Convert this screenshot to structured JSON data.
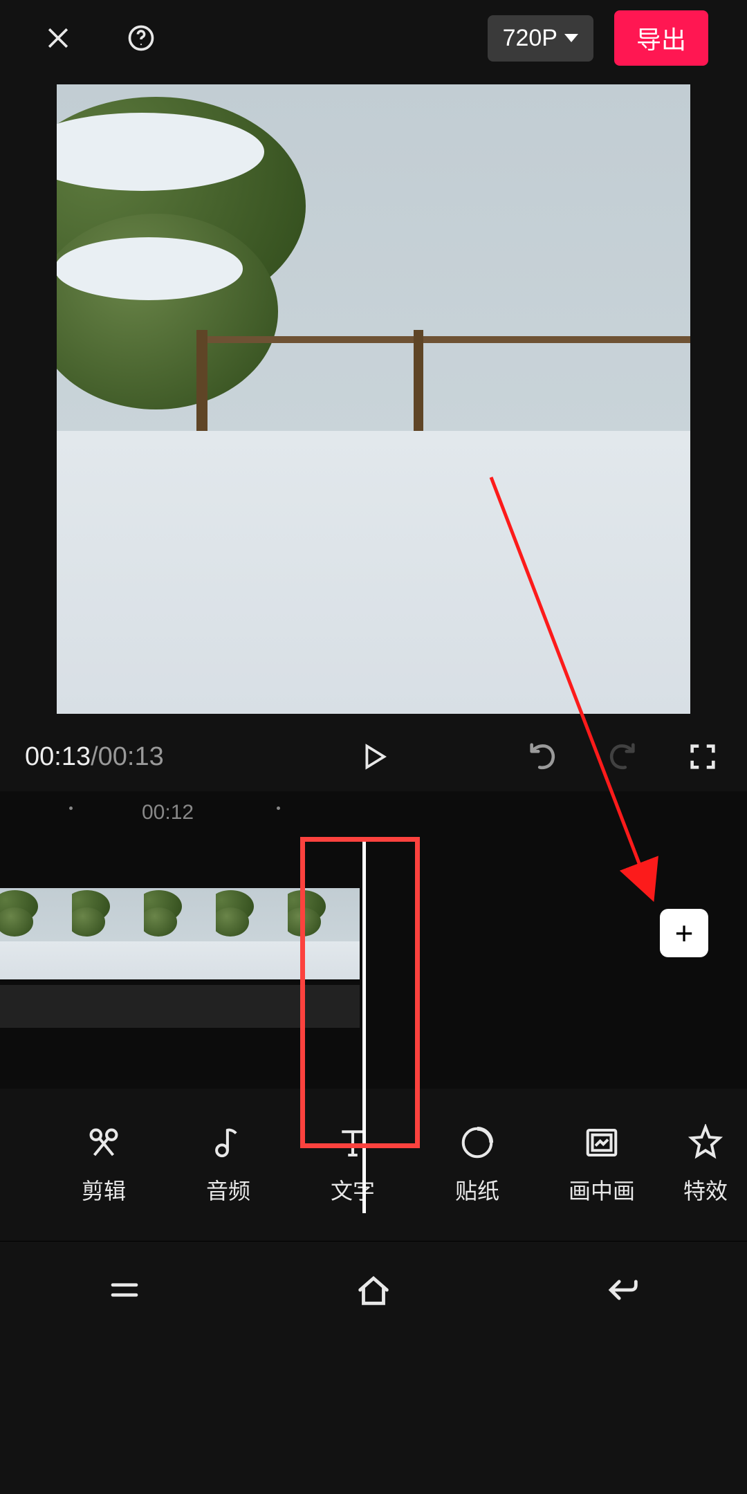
{
  "topbar": {
    "resolution_label": "720P",
    "export_label": "导出"
  },
  "playback": {
    "current_time": "00:13",
    "total_time": "00:13",
    "separator": " / "
  },
  "timeline": {
    "ruler_label": "00:12"
  },
  "toolbar": {
    "items": [
      {
        "label": "剪辑",
        "icon": "scissors"
      },
      {
        "label": "音频",
        "icon": "music-note"
      },
      {
        "label": "文字",
        "icon": "text"
      },
      {
        "label": "贴纸",
        "icon": "sticker"
      },
      {
        "label": "画中画",
        "icon": "pip"
      },
      {
        "label": "特效",
        "icon": "star"
      }
    ]
  },
  "annotation": {
    "arrow_color": "#fc1b1b"
  }
}
